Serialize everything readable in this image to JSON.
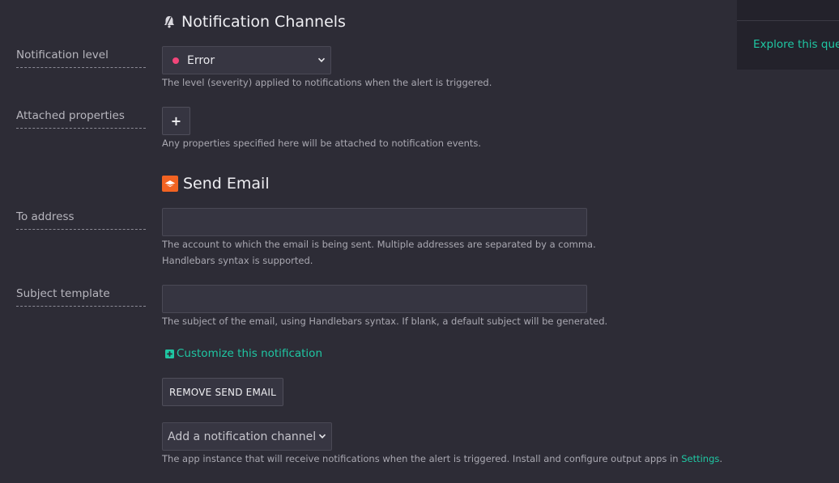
{
  "notification_channels": {
    "title": "Notification Channels",
    "icon": "bell-icon",
    "level": {
      "label": "Notification level",
      "selected": "Error",
      "dot_color": "#f2467a",
      "help": "The level (severity) applied to notifications when the alert is triggered."
    },
    "attached_properties": {
      "label": "Attached properties",
      "add_label": "+",
      "help": "Any properties specified here will be attached to notification events."
    }
  },
  "send_email": {
    "title": "Send Email",
    "icon": "email-app-icon",
    "icon_color": "#f26322",
    "to_address": {
      "label": "To address",
      "value": "",
      "help_line1": "The account to which the email is being sent. Multiple addresses are separated by a comma.",
      "help_line2": "Handlebars syntax is supported."
    },
    "subject_template": {
      "label": "Subject template",
      "value": "",
      "help": "The subject of the email, using Handlebars syntax. If blank, a default subject will be generated."
    },
    "customize_label": "Customize this notification",
    "remove_label": "REMOVE SEND EMAIL"
  },
  "add_channel": {
    "placeholder": "Add a notification channel",
    "help_prefix": "The app instance that will receive notifications when the alert is triggered. Install and configure output apps in",
    "settings_link": "Settings",
    "help_suffix": "."
  },
  "right_panel": {
    "explore_link": "Explore this query"
  },
  "colors": {
    "background": "#2d2c36",
    "accent": "#1fc7a3",
    "panel": "#23222b"
  }
}
